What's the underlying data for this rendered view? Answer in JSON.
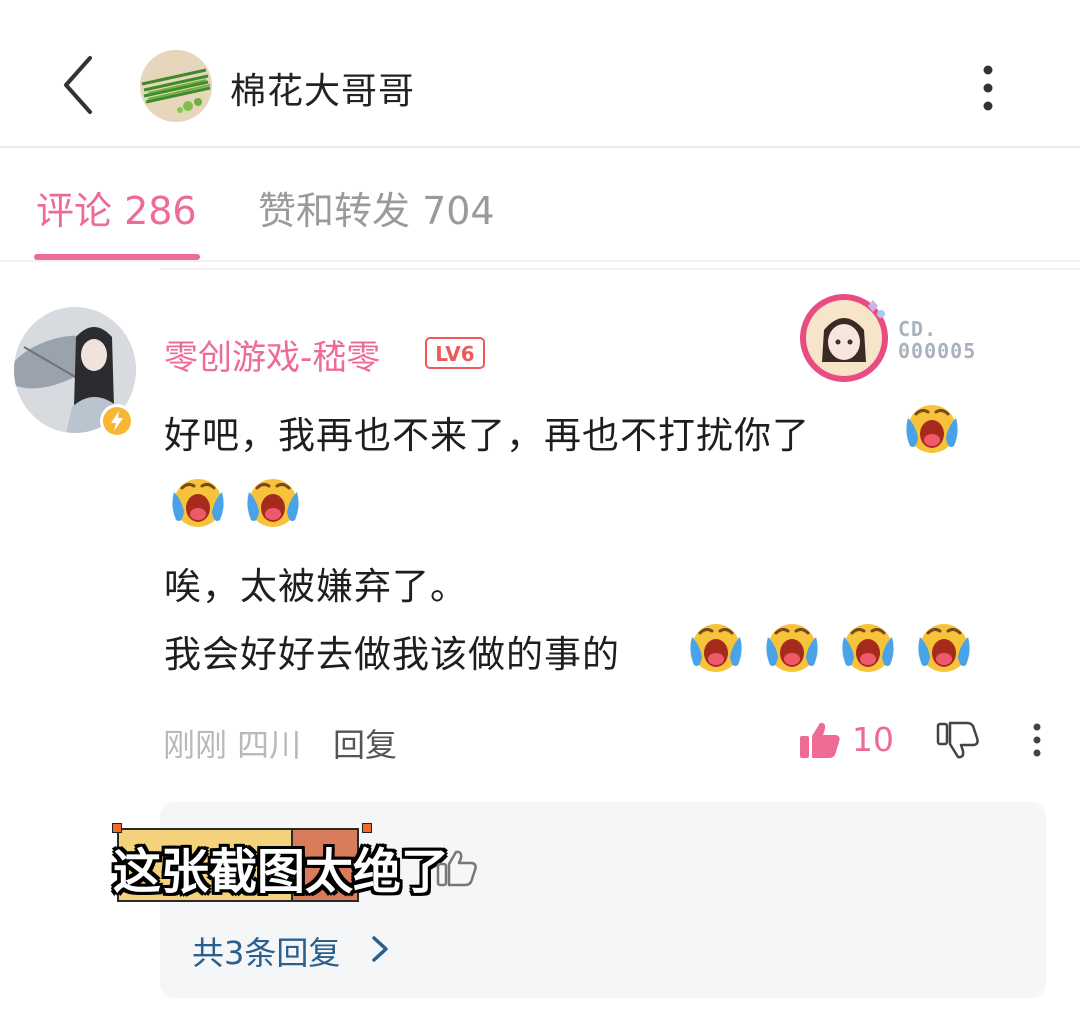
{
  "header": {
    "title": "棉花大哥哥",
    "back_icon": "chevron-left-icon",
    "more_icon": "more-vertical-icon"
  },
  "tabs": [
    {
      "label": "评论 286",
      "active": true
    },
    {
      "label": "赞和转发 704",
      "active": false
    }
  ],
  "comment": {
    "username": "零创游戏-嵇零",
    "level": "LV6",
    "pendant_text": [
      "CD.",
      "000005"
    ],
    "lines": [
      "好吧，我再也不来了，再也不打扰你了",
      "",
      "唉，太被嫌弃了。",
      "我会好好去做我该做的事的"
    ],
    "emoji_name": "crying-face-emoji",
    "time_location": "刚刚 四川",
    "reply_label": "回复",
    "like_count": "10",
    "replies_link": "共3条回复"
  },
  "overlay_caption": "这张截图太绝了",
  "colors": {
    "accent_pink": "#ee6b94",
    "link_blue": "#2b5f8e",
    "caption_yellow": "#f4d27b"
  }
}
